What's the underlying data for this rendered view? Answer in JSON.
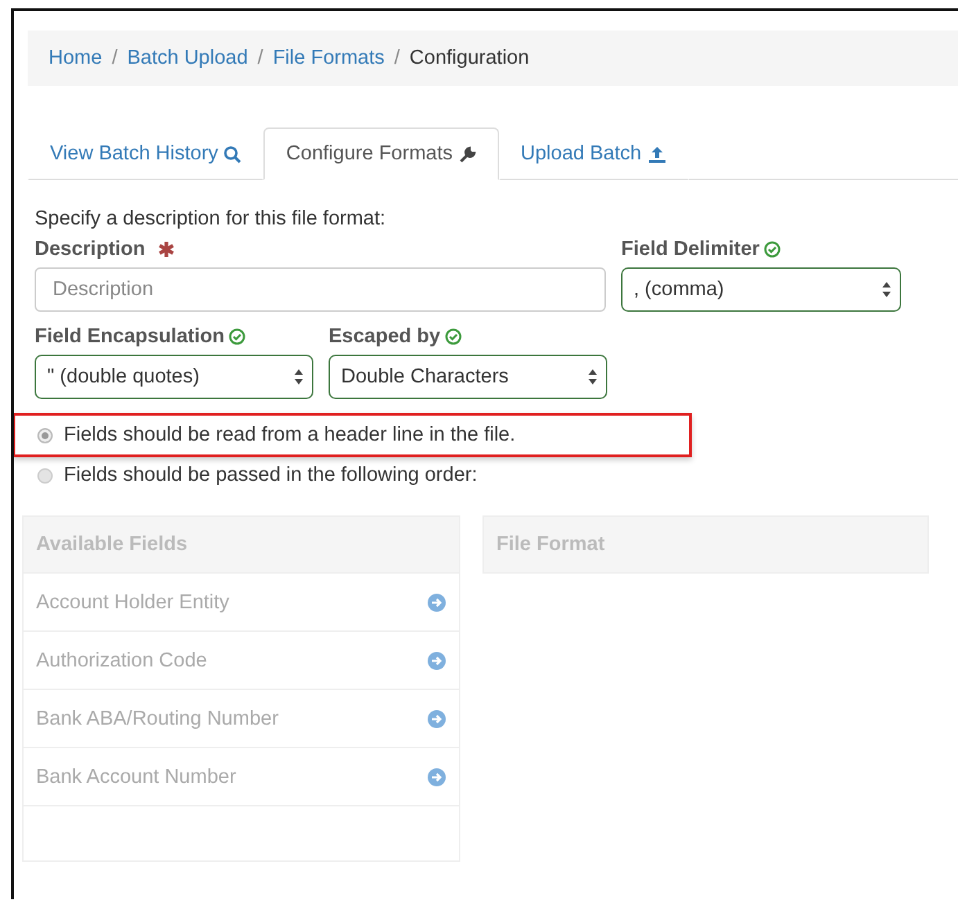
{
  "breadcrumb_separator": "/",
  "breadcrumb": [
    {
      "label": "Home",
      "link": true
    },
    {
      "label": "Batch Upload",
      "link": true
    },
    {
      "label": "File Formats",
      "link": true
    },
    {
      "label": "Configuration",
      "link": false
    }
  ],
  "tabs": [
    {
      "label": "View Batch History",
      "selected": false
    },
    {
      "label": "Configure Formats",
      "selected": true
    },
    {
      "label": "Upload Batch",
      "selected": false
    }
  ],
  "intro": "Specify a description for this file format:",
  "description": {
    "label": "Description",
    "required": true,
    "placeholder": "Description"
  },
  "field_delimiter": {
    "label": "Field Delimiter",
    "valid": true,
    "value": ", (comma)"
  },
  "field_encapsulation": {
    "label": "Field Encapsulation",
    "valid": true,
    "value": "\" (double quotes)"
  },
  "escaped_by": {
    "label": "Escaped by",
    "valid": true,
    "value": "Double Characters"
  },
  "header_options": [
    {
      "label": "Fields should be read from a header line in the file.",
      "selected": true,
      "highlighted": true
    },
    {
      "label": "Fields should be passed in the following order:",
      "selected": false,
      "highlighted": false
    }
  ],
  "available_fields": {
    "title": "Available Fields",
    "items": [
      "Account Holder Entity",
      "Authorization Code",
      "Bank ABA/Routing Number",
      "Bank Account Number"
    ]
  },
  "file_format": {
    "title": "File Format"
  }
}
